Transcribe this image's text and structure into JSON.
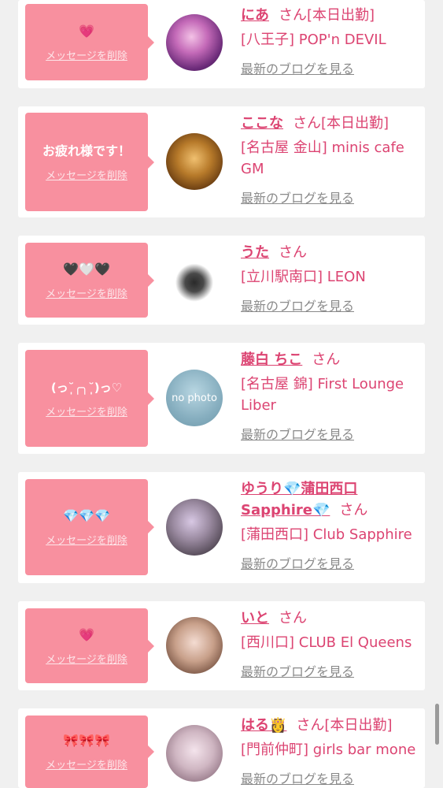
{
  "delete_label": "メッセージを削除",
  "blog_label": "最新のブログを見る",
  "san_label": "さん",
  "colors": {
    "accent": "#f8909f",
    "name": "#dc4472",
    "background": "#f0f0f0",
    "link_gray": "#8a8a8a"
  },
  "cards": [
    {
      "message": "💗",
      "name": "にあ",
      "status": "[本日出勤]",
      "shop": "[八王子] POP'n DEVIL"
    },
    {
      "message": "お疲れ様です！",
      "name": "ここな",
      "status": "[本日出勤]",
      "shop": "[名古屋 金山] minis cafe GM"
    },
    {
      "message": "🖤🤍🖤",
      "name": "うた",
      "status": "",
      "shop": "[立川駅南口] LEON"
    },
    {
      "message": "(っ˘̩╭╮˘̩)っ♡",
      "name": "藤白 ちこ",
      "status": "",
      "shop": "[名古屋 錦] First Lounge Liber",
      "avatar_text": "no photo"
    },
    {
      "message": "💎💎💎",
      "name": "ゆうり💎蒲田西口Sapphire💎",
      "status": "",
      "shop": "[蒲田西口] Club Sapphire"
    },
    {
      "message": "💗",
      "name": "いと",
      "status": "",
      "shop": "[西川口] CLUB El Queens"
    },
    {
      "message": "🎀🎀🎀",
      "name": "はる👸",
      "status": "[本日出勤]",
      "shop": "[門前仲町] girls bar mone"
    }
  ]
}
